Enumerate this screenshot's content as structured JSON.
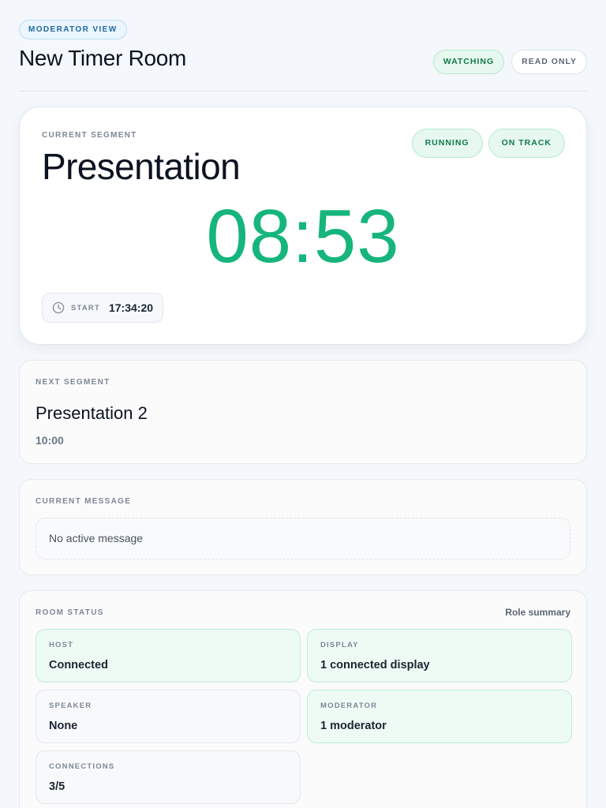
{
  "header": {
    "view_label": "MODERATOR VIEW",
    "room_title": "New Timer Room",
    "badges": [
      {
        "label": "WATCHING",
        "tone": "green"
      },
      {
        "label": "READ ONLY",
        "tone": "grey"
      }
    ]
  },
  "current_segment": {
    "eyebrow": "CURRENT SEGMENT",
    "title": "Presentation",
    "badges": [
      {
        "label": "RUNNING"
      },
      {
        "label": "ON TRACK"
      }
    ],
    "timer": "08:53",
    "start_icon": "clock-icon",
    "start_label": "START",
    "start_time": "17:34:20"
  },
  "next_segment": {
    "eyebrow": "NEXT SEGMENT",
    "title": "Presentation 2",
    "duration": "10:00"
  },
  "current_message": {
    "eyebrow": "CURRENT MESSAGE",
    "text": "No active message"
  },
  "room_status": {
    "eyebrow": "ROOM STATUS",
    "summary_link": "Role summary",
    "tiles": {
      "host": {
        "label": "HOST",
        "value": "Connected",
        "state": "ok"
      },
      "display": {
        "label": "DISPLAY",
        "value": "1 connected display",
        "state": "ok"
      },
      "speaker": {
        "label": "SPEAKER",
        "value": "None",
        "state": "neutral"
      },
      "moderator": {
        "label": "MODERATOR",
        "value": "1 moderator",
        "state": "ok"
      },
      "connections": {
        "label": "CONNECTIONS",
        "value": "3/5",
        "state": "neutral"
      }
    }
  },
  "colors": {
    "accent_green": "#16b57c",
    "view_pill_blue": "#1f6a9e",
    "page_background": "#f4f7fb"
  }
}
